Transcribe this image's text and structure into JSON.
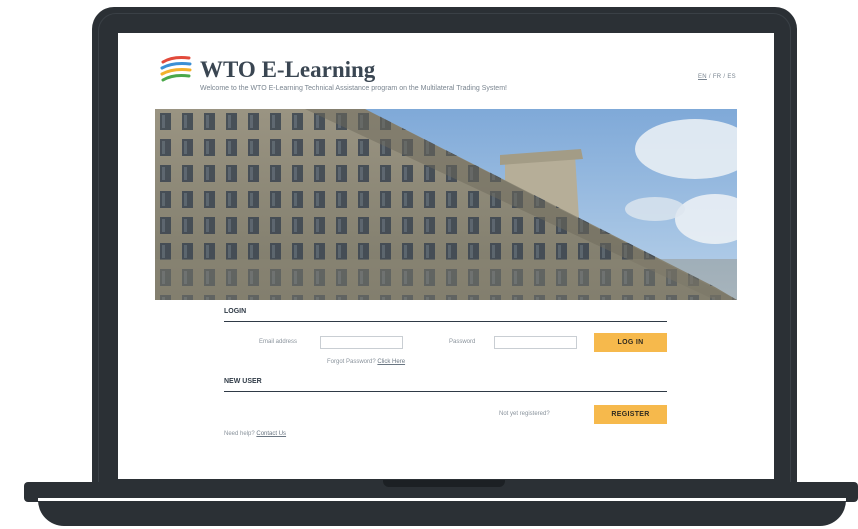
{
  "header": {
    "brand": "WTO E-Learning",
    "tagline": "Welcome to the WTO E-Learning Technical Assistance program on the Multilateral Trading System!",
    "languages": [
      "EN",
      "FR",
      "ES"
    ],
    "lang_sep": " / "
  },
  "login": {
    "title": "LOGIN",
    "email_label": "Email address",
    "email_value": "",
    "password_label": "Password",
    "password_value": "",
    "button": "LOG IN",
    "forgot_text": "Forgot Password?",
    "forgot_link": "Click Here"
  },
  "new_user": {
    "title": "NEW USER",
    "prompt": "Not yet registered?",
    "button": "REGISTER"
  },
  "help": {
    "text": "Need help?",
    "link": "Contact Us"
  },
  "colors": {
    "frame": "#2b3035",
    "accent": "#f6b94c",
    "heading": "#2f3a46"
  }
}
